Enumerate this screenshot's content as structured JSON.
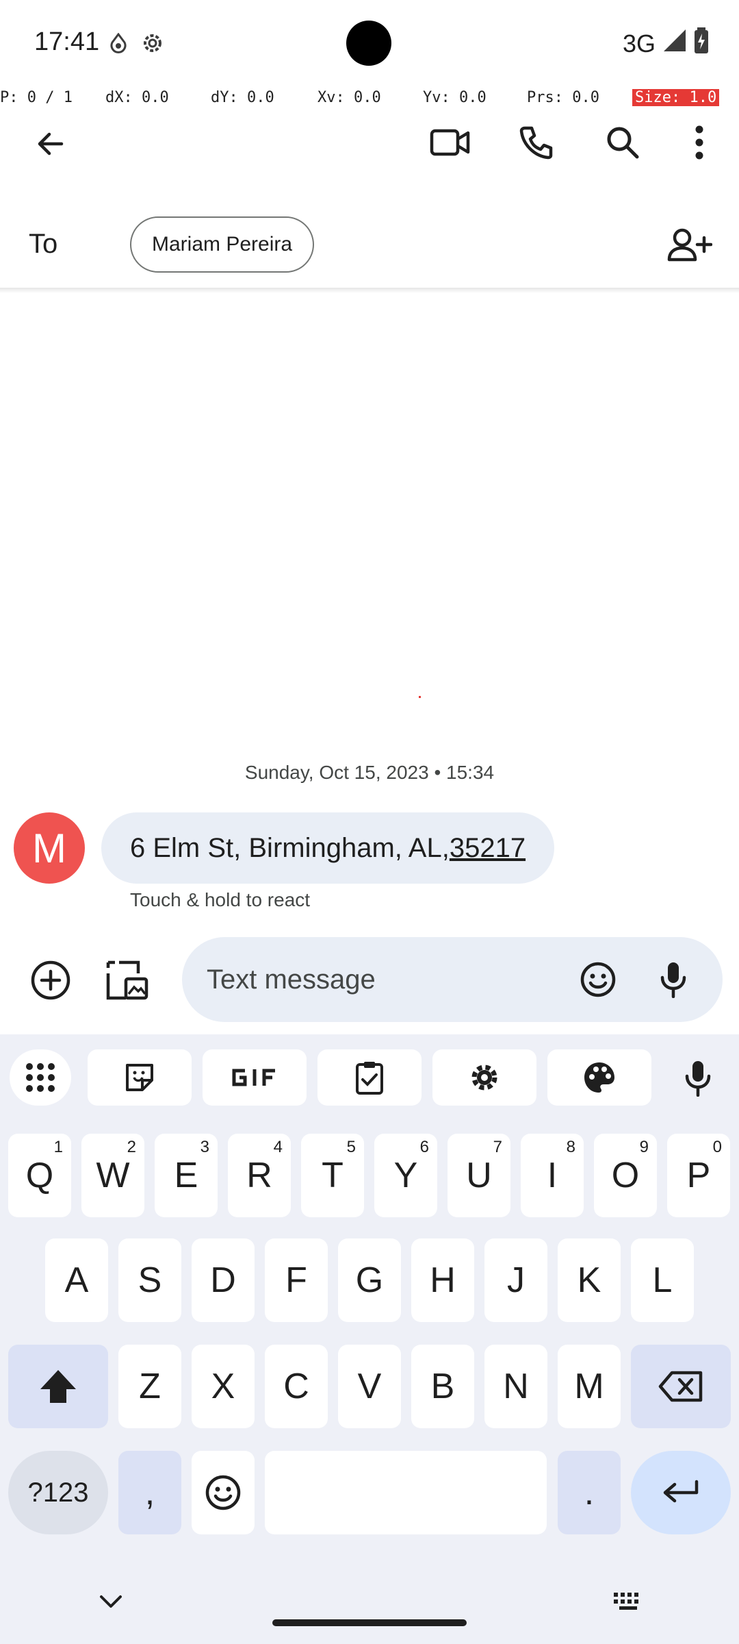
{
  "status_bar": {
    "time": "17:41",
    "network": "3G"
  },
  "debug": {
    "p": "P: 0 / 1",
    "dx": "dX: 0.0",
    "dy": "dY: 0.0",
    "xv": "Xv: 0.0",
    "yv": "Yv: 0.0",
    "prs": "Prs: 0.0",
    "size": "Size: 1.0"
  },
  "header": {
    "to_label": "To",
    "recipient": "Mariam Pereira"
  },
  "conversation": {
    "date": "Sunday, Oct 15, 2023 • 15:34",
    "avatar_letter": "M",
    "message_text": "6 Elm St, Birmingham, AL, ",
    "message_zip": "35217",
    "react_hint": "Touch & hold to react"
  },
  "compose": {
    "placeholder": "Text message"
  },
  "keyboard": {
    "row1": [
      {
        "key": "Q",
        "hint": "1"
      },
      {
        "key": "W",
        "hint": "2"
      },
      {
        "key": "E",
        "hint": "3"
      },
      {
        "key": "R",
        "hint": "4"
      },
      {
        "key": "T",
        "hint": "5"
      },
      {
        "key": "Y",
        "hint": "6"
      },
      {
        "key": "U",
        "hint": "7"
      },
      {
        "key": "I",
        "hint": "8"
      },
      {
        "key": "O",
        "hint": "9"
      },
      {
        "key": "P",
        "hint": "0"
      }
    ],
    "row2": [
      "A",
      "S",
      "D",
      "F",
      "G",
      "H",
      "J",
      "K",
      "L"
    ],
    "row3": [
      "Z",
      "X",
      "C",
      "V",
      "B",
      "N",
      "M"
    ],
    "symbols_label": "?123",
    "comma": ",",
    "period": "."
  }
}
